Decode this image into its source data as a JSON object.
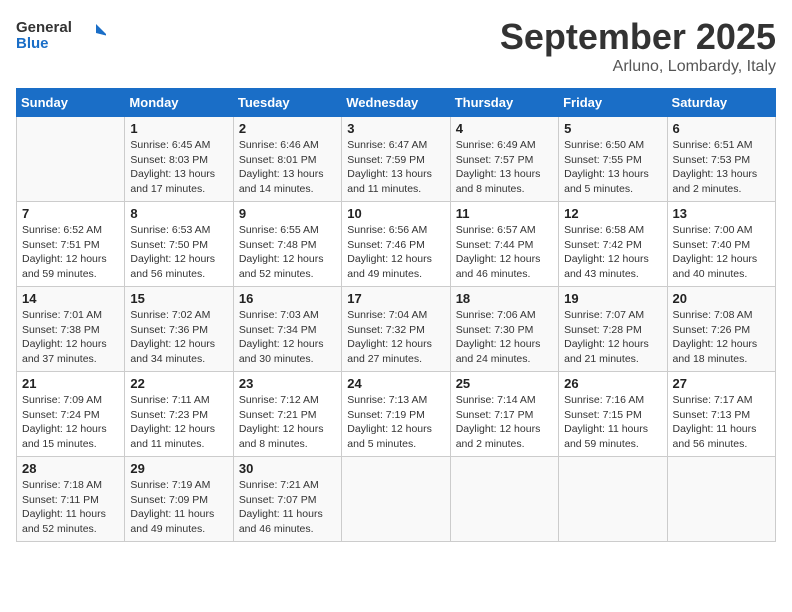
{
  "header": {
    "logo_general": "General",
    "logo_blue": "Blue",
    "month": "September 2025",
    "location": "Arluno, Lombardy, Italy"
  },
  "weekdays": [
    "Sunday",
    "Monday",
    "Tuesday",
    "Wednesday",
    "Thursday",
    "Friday",
    "Saturday"
  ],
  "weeks": [
    [
      {
        "day": "",
        "info": ""
      },
      {
        "day": "1",
        "info": "Sunrise: 6:45 AM\nSunset: 8:03 PM\nDaylight: 13 hours\nand 17 minutes."
      },
      {
        "day": "2",
        "info": "Sunrise: 6:46 AM\nSunset: 8:01 PM\nDaylight: 13 hours\nand 14 minutes."
      },
      {
        "day": "3",
        "info": "Sunrise: 6:47 AM\nSunset: 7:59 PM\nDaylight: 13 hours\nand 11 minutes."
      },
      {
        "day": "4",
        "info": "Sunrise: 6:49 AM\nSunset: 7:57 PM\nDaylight: 13 hours\nand 8 minutes."
      },
      {
        "day": "5",
        "info": "Sunrise: 6:50 AM\nSunset: 7:55 PM\nDaylight: 13 hours\nand 5 minutes."
      },
      {
        "day": "6",
        "info": "Sunrise: 6:51 AM\nSunset: 7:53 PM\nDaylight: 13 hours\nand 2 minutes."
      }
    ],
    [
      {
        "day": "7",
        "info": "Sunrise: 6:52 AM\nSunset: 7:51 PM\nDaylight: 12 hours\nand 59 minutes."
      },
      {
        "day": "8",
        "info": "Sunrise: 6:53 AM\nSunset: 7:50 PM\nDaylight: 12 hours\nand 56 minutes."
      },
      {
        "day": "9",
        "info": "Sunrise: 6:55 AM\nSunset: 7:48 PM\nDaylight: 12 hours\nand 52 minutes."
      },
      {
        "day": "10",
        "info": "Sunrise: 6:56 AM\nSunset: 7:46 PM\nDaylight: 12 hours\nand 49 minutes."
      },
      {
        "day": "11",
        "info": "Sunrise: 6:57 AM\nSunset: 7:44 PM\nDaylight: 12 hours\nand 46 minutes."
      },
      {
        "day": "12",
        "info": "Sunrise: 6:58 AM\nSunset: 7:42 PM\nDaylight: 12 hours\nand 43 minutes."
      },
      {
        "day": "13",
        "info": "Sunrise: 7:00 AM\nSunset: 7:40 PM\nDaylight: 12 hours\nand 40 minutes."
      }
    ],
    [
      {
        "day": "14",
        "info": "Sunrise: 7:01 AM\nSunset: 7:38 PM\nDaylight: 12 hours\nand 37 minutes."
      },
      {
        "day": "15",
        "info": "Sunrise: 7:02 AM\nSunset: 7:36 PM\nDaylight: 12 hours\nand 34 minutes."
      },
      {
        "day": "16",
        "info": "Sunrise: 7:03 AM\nSunset: 7:34 PM\nDaylight: 12 hours\nand 30 minutes."
      },
      {
        "day": "17",
        "info": "Sunrise: 7:04 AM\nSunset: 7:32 PM\nDaylight: 12 hours\nand 27 minutes."
      },
      {
        "day": "18",
        "info": "Sunrise: 7:06 AM\nSunset: 7:30 PM\nDaylight: 12 hours\nand 24 minutes."
      },
      {
        "day": "19",
        "info": "Sunrise: 7:07 AM\nSunset: 7:28 PM\nDaylight: 12 hours\nand 21 minutes."
      },
      {
        "day": "20",
        "info": "Sunrise: 7:08 AM\nSunset: 7:26 PM\nDaylight: 12 hours\nand 18 minutes."
      }
    ],
    [
      {
        "day": "21",
        "info": "Sunrise: 7:09 AM\nSunset: 7:24 PM\nDaylight: 12 hours\nand 15 minutes."
      },
      {
        "day": "22",
        "info": "Sunrise: 7:11 AM\nSunset: 7:23 PM\nDaylight: 12 hours\nand 11 minutes."
      },
      {
        "day": "23",
        "info": "Sunrise: 7:12 AM\nSunset: 7:21 PM\nDaylight: 12 hours\nand 8 minutes."
      },
      {
        "day": "24",
        "info": "Sunrise: 7:13 AM\nSunset: 7:19 PM\nDaylight: 12 hours\nand 5 minutes."
      },
      {
        "day": "25",
        "info": "Sunrise: 7:14 AM\nSunset: 7:17 PM\nDaylight: 12 hours\nand 2 minutes."
      },
      {
        "day": "26",
        "info": "Sunrise: 7:16 AM\nSunset: 7:15 PM\nDaylight: 11 hours\nand 59 minutes."
      },
      {
        "day": "27",
        "info": "Sunrise: 7:17 AM\nSunset: 7:13 PM\nDaylight: 11 hours\nand 56 minutes."
      }
    ],
    [
      {
        "day": "28",
        "info": "Sunrise: 7:18 AM\nSunset: 7:11 PM\nDaylight: 11 hours\nand 52 minutes."
      },
      {
        "day": "29",
        "info": "Sunrise: 7:19 AM\nSunset: 7:09 PM\nDaylight: 11 hours\nand 49 minutes."
      },
      {
        "day": "30",
        "info": "Sunrise: 7:21 AM\nSunset: 7:07 PM\nDaylight: 11 hours\nand 46 minutes."
      },
      {
        "day": "",
        "info": ""
      },
      {
        "day": "",
        "info": ""
      },
      {
        "day": "",
        "info": ""
      },
      {
        "day": "",
        "info": ""
      }
    ]
  ]
}
